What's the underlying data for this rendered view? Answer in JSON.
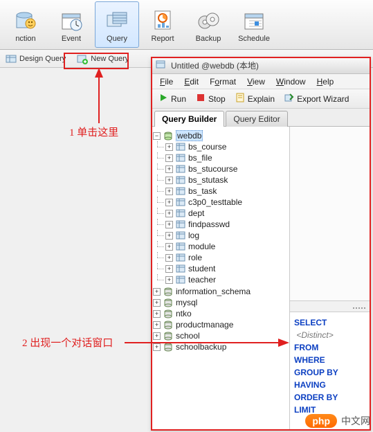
{
  "toolbar": {
    "items": [
      {
        "label": "nction"
      },
      {
        "label": "Event"
      },
      {
        "label": "Query"
      },
      {
        "label": "Report"
      },
      {
        "label": "Backup"
      },
      {
        "label": "Schedule"
      }
    ]
  },
  "subtoolbar": {
    "design_query": "Design Query",
    "new_query": "New Query"
  },
  "child": {
    "title": "Untitled @webdb (本地)",
    "menu": {
      "file": "File",
      "edit": "Edit",
      "format": "Format",
      "view": "View",
      "window": "Window",
      "help": "Help"
    },
    "tools": {
      "run": "Run",
      "stop": "Stop",
      "explain": "Explain",
      "export": "Export Wizard"
    },
    "tabs": {
      "builder": "Query Builder",
      "editor": "Query Editor"
    },
    "keywords": [
      "SELECT",
      "FROM",
      "WHERE",
      "GROUP BY",
      "HAVING",
      "ORDER BY",
      "LIMIT"
    ],
    "distinct": "<Distinct>"
  },
  "tree": {
    "root": "webdb",
    "tables": [
      "bs_course",
      "bs_file",
      "bs_stucourse",
      "bs_stutask",
      "bs_task",
      "c3p0_testtable",
      "dept",
      "findpasswd",
      "log",
      "module",
      "role",
      "student",
      "teacher"
    ],
    "dbs": [
      "information_schema",
      "mysql",
      "ntko",
      "productmanage",
      "school",
      "schoolbackup"
    ]
  },
  "annotations": {
    "step1": "1 单击这里",
    "step2": "2 出现一个对话窗口"
  },
  "watermark": {
    "badge": "php",
    "text": "中文网"
  }
}
